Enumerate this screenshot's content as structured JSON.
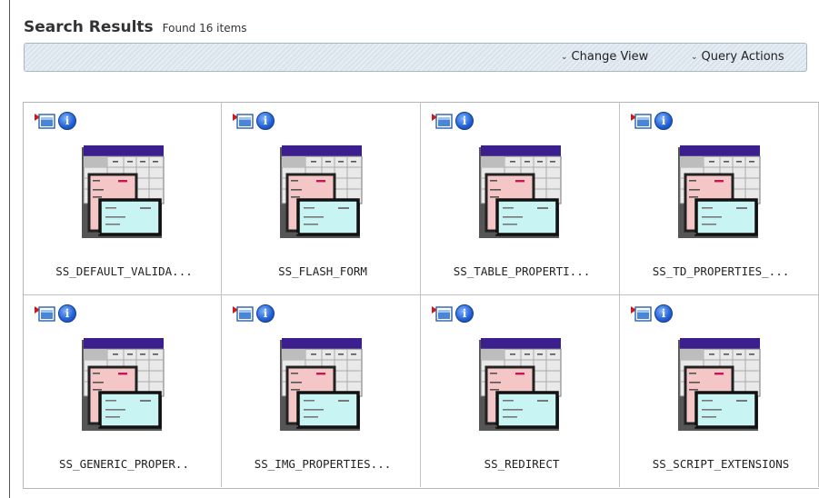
{
  "header": {
    "title": "Search Results",
    "count_text": "Found 16 items"
  },
  "toolbar": {
    "change_view_label": "Change View",
    "query_actions_label": "Query Actions"
  },
  "results": [
    {
      "name": "SS_DEFAULT_VALIDA..."
    },
    {
      "name": "SS_FLASH_FORM"
    },
    {
      "name": "SS_TABLE_PROPERTI..."
    },
    {
      "name": "SS_TD_PROPERTIES_..."
    },
    {
      "name": "SS_GENERIC_PROPER.."
    },
    {
      "name": "SS_IMG_PROPERTIES..."
    },
    {
      "name": "SS_REDIRECT"
    },
    {
      "name": "SS_SCRIPT_EXTENSIONS"
    }
  ],
  "icons": {
    "open": "open-item-icon",
    "info": "info-icon",
    "thumbnail": "form-document-icon",
    "dropdown": "chevron-down-icon"
  },
  "colors": {
    "thumb_header": "#3b1f8f",
    "thumb_card": "#c9f4f4",
    "thumb_form": "#f4c6c6",
    "info": "#1f5fd6"
  }
}
